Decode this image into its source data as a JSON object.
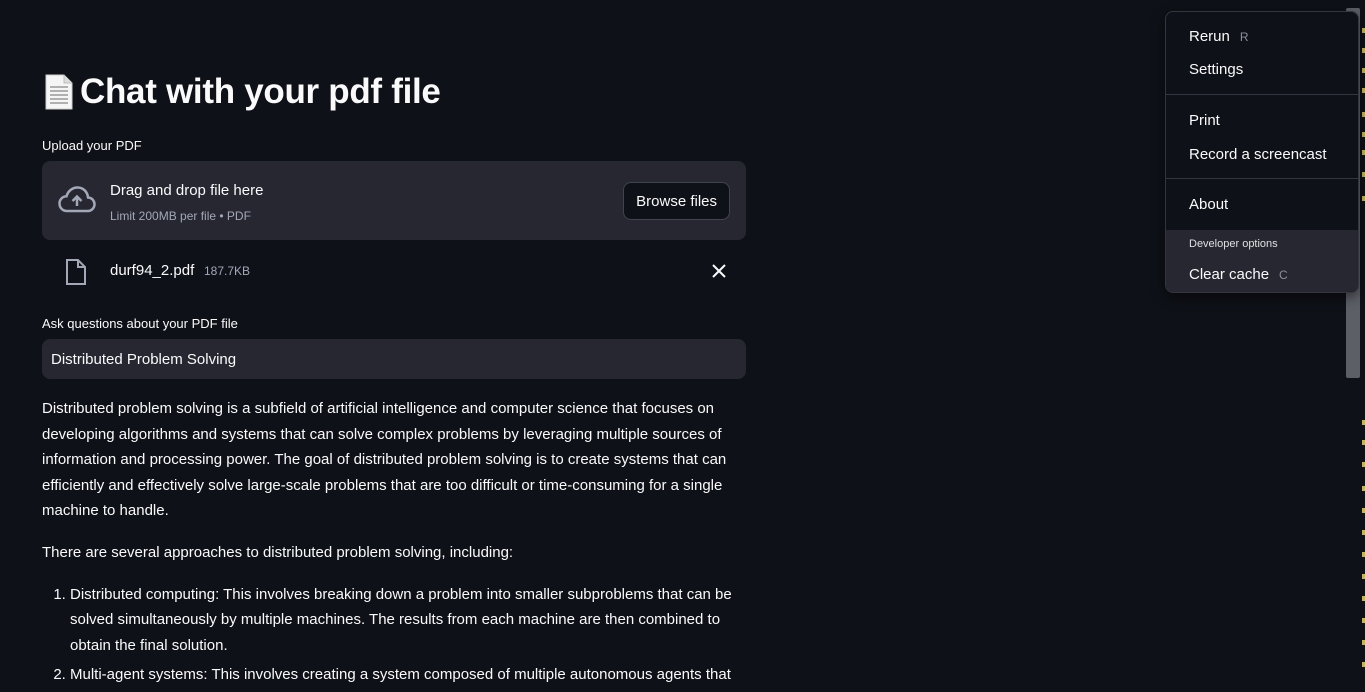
{
  "header": {
    "title": "Chat with your pdf file"
  },
  "uploader": {
    "label": "Upload your PDF",
    "drag_text": "Drag and drop file here",
    "limit_text": "Limit 200MB per file • PDF",
    "browse_label": "Browse files",
    "file": {
      "name": "durf94_2.pdf",
      "size": "187.7KB"
    }
  },
  "question": {
    "label": "Ask questions about your PDF file",
    "value": "Distributed Problem Solving"
  },
  "answer": {
    "paragraph1": "Distributed problem solving is a subfield of artificial intelligence and computer science that focuses on developing algorithms and systems that can solve complex problems by leveraging multiple sources of information and processing power. The goal of distributed problem solving is to create systems that can efficiently and effectively solve large-scale problems that are too difficult or time-consuming for a single machine to handle.",
    "paragraph2": "There are several approaches to distributed problem solving, including:",
    "items": [
      "Distributed computing: This involves breaking down a problem into smaller subproblems that can be solved simultaneously by multiple machines. The results from each machine are then combined to obtain the final solution.",
      "Multi-agent systems: This involves creating a system composed of multiple autonomous agents that"
    ]
  },
  "menu": {
    "rerun": {
      "label": "Rerun",
      "shortcut": "R"
    },
    "settings": "Settings",
    "print": "Print",
    "screencast": "Record a screencast",
    "about": "About",
    "developer_title": "Developer options",
    "clear_cache": {
      "label": "Clear cache",
      "shortcut": "C"
    }
  },
  "colors": {
    "background": "#0e1117",
    "surface": "#262730",
    "text": "#fafafa",
    "muted": "#a3a8b8"
  },
  "icons": [
    "page-facing-up-icon",
    "cloud-upload-icon",
    "file-icon",
    "close-icon"
  ]
}
